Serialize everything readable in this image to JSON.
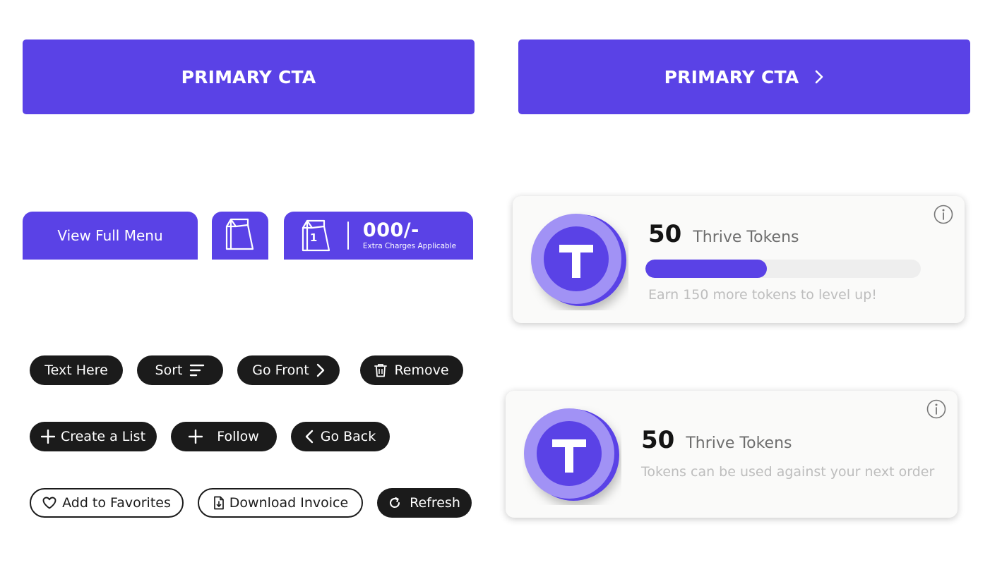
{
  "colors": {
    "brand": "#5a42e6",
    "dark": "#1b1b1b",
    "coin_light": "#a192f5",
    "coin_dark": "#5a42e6"
  },
  "cta": {
    "primary_label": "PRIMARY CTA",
    "primary_arrow_label": "PRIMARY CTA",
    "arrow_icon": "chevron-right-icon"
  },
  "menu": {
    "view_full_menu": "View Full Menu",
    "bag_icon": "shopping-bag-icon",
    "bag_count": "1",
    "price": "000/-",
    "price_note": "Extra Charges Applicable"
  },
  "pills": {
    "text_here": "Text Here",
    "sort": "Sort",
    "go_front": "Go Front",
    "remove": "Remove",
    "create_list": "Create a List",
    "follow": "Follow",
    "go_back": "Go Back",
    "add_favorites": "Add to Favorites",
    "download_invoice": "Download Invoice",
    "refresh": "Refresh"
  },
  "token_card_progress": {
    "coin_letter": "T",
    "count": "50",
    "label": "Thrive Tokens",
    "progress_fraction": 0.44,
    "hint": "Earn 150 more tokens to level up!",
    "info_icon": "info-icon"
  },
  "token_card_info": {
    "coin_letter": "T",
    "count": "50",
    "label": "Thrive Tokens",
    "hint": "Tokens can be used against your next order",
    "info_icon": "info-icon"
  }
}
